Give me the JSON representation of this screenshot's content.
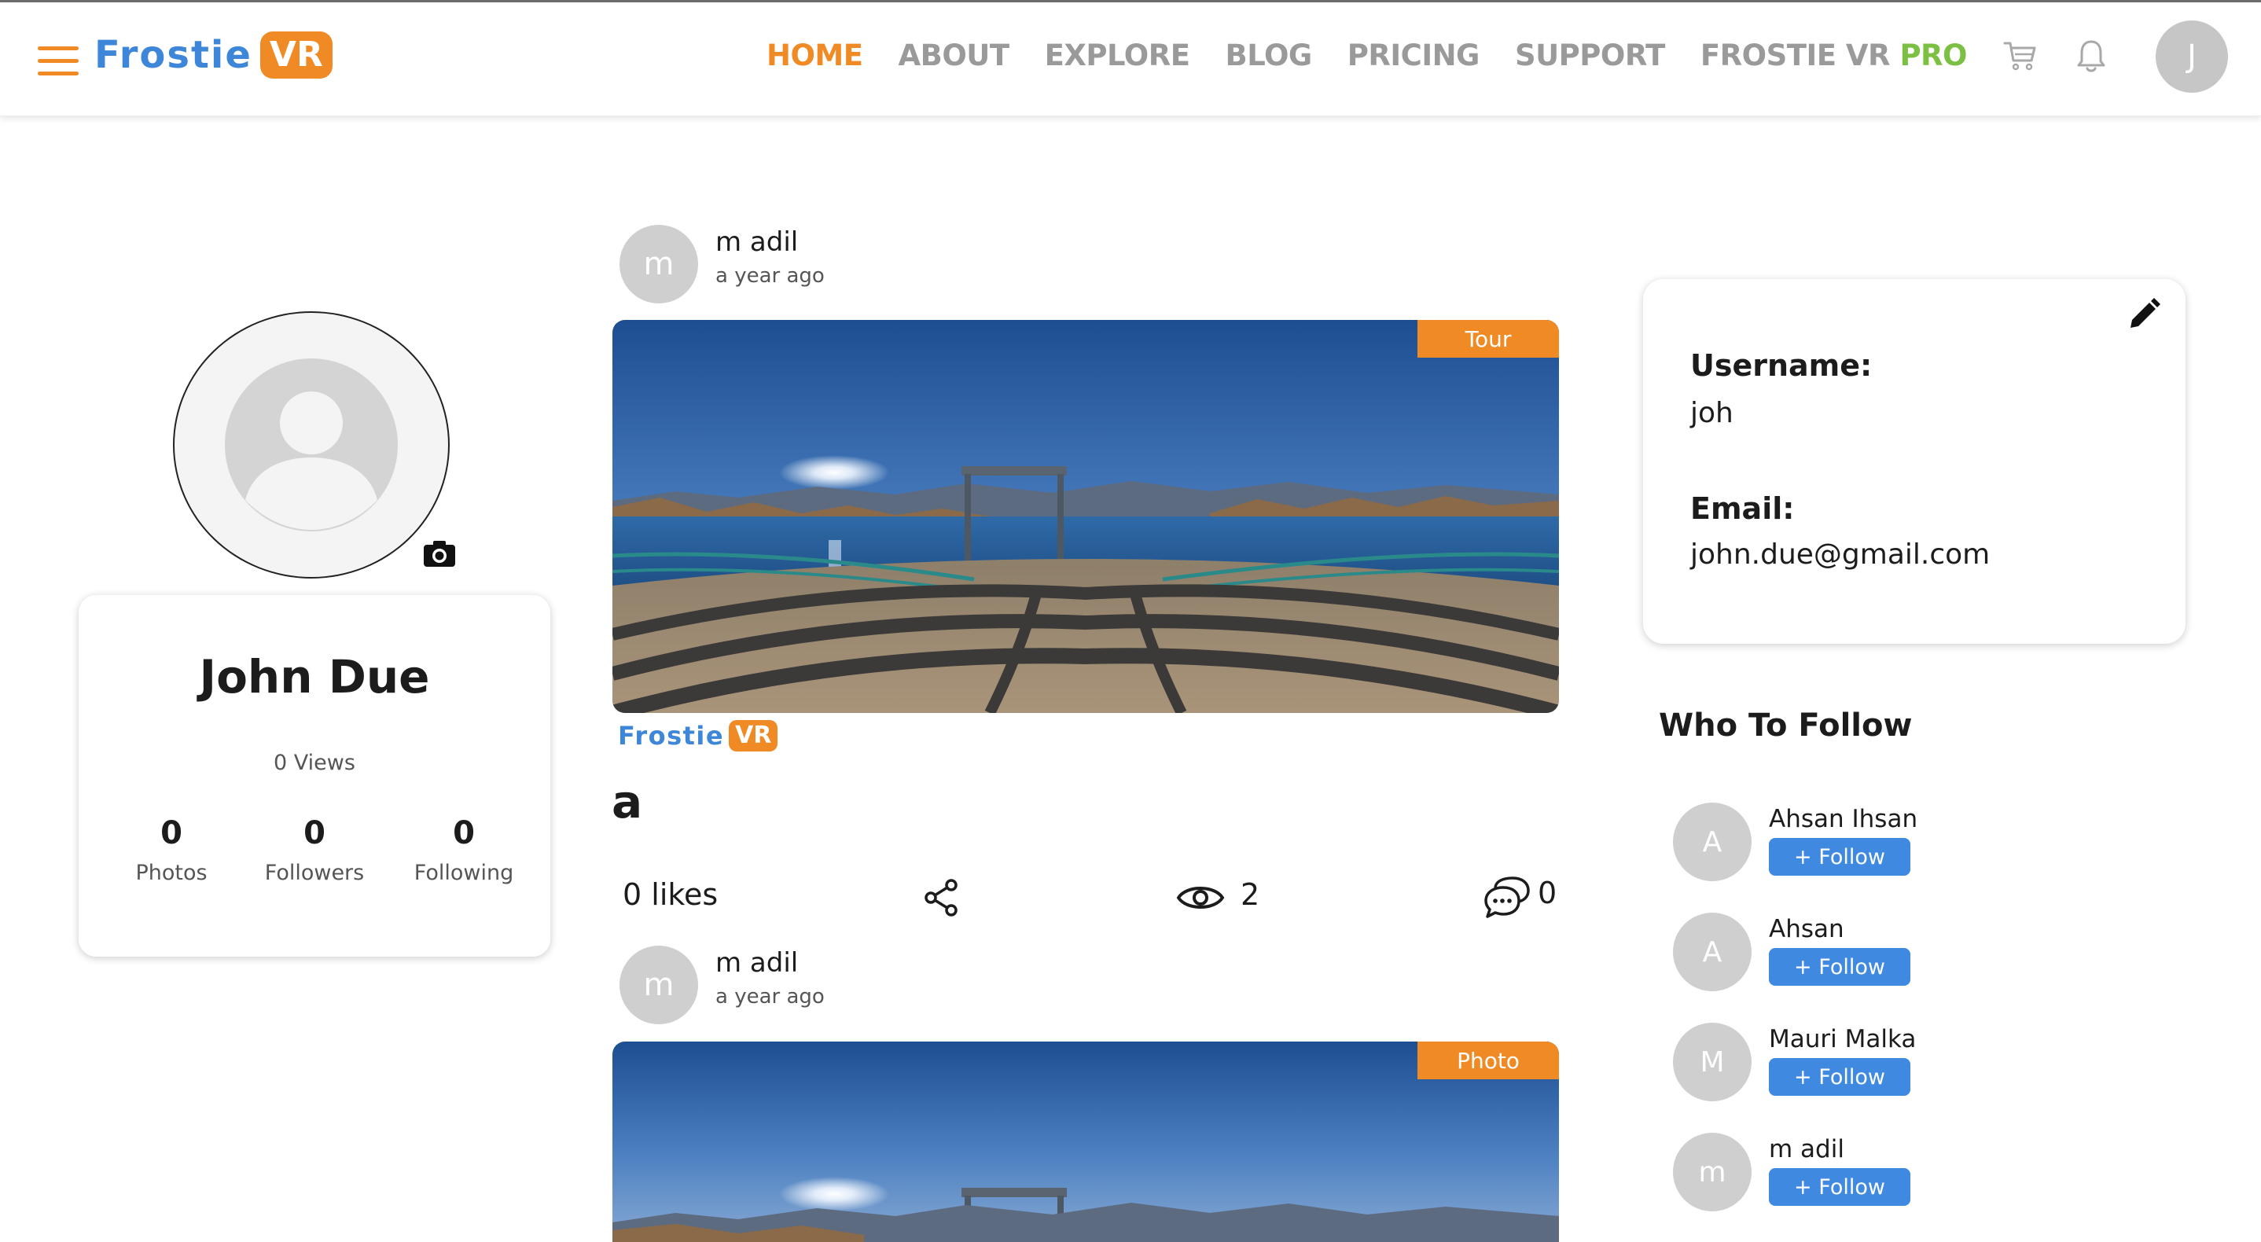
{
  "header": {
    "logo_text": "Frostie",
    "logo_badge": "VR",
    "nav": [
      "HOME",
      "ABOUT",
      "EXPLORE",
      "BLOG",
      "PRICING",
      "SUPPORT"
    ],
    "nav_pro_prefix": "FROSTIE VR",
    "nav_pro_suffix": "PRO",
    "user_initial": "J",
    "icons": [
      "menu-icon",
      "cart-icon",
      "bell-icon"
    ],
    "colors": {
      "accent": "#f08a24",
      "brand_blue": "#3d86d8",
      "pro_green": "#7bc043",
      "nav_gray": "#9a9a9a"
    }
  },
  "profile": {
    "name": "John Due",
    "views": "0 Views",
    "stats": [
      {
        "value": "0",
        "label": "Photos"
      },
      {
        "value": "0",
        "label": "Followers"
      },
      {
        "value": "0",
        "label": "Following"
      }
    ]
  },
  "posts": [
    {
      "avatar_initial": "m",
      "author": "m adil",
      "time": "a year ago",
      "tag": "Tour",
      "watermark_text": "Frostie",
      "watermark_badge": "VR",
      "title": "a",
      "likes": "0 likes",
      "views": "2",
      "comments": "0"
    },
    {
      "avatar_initial": "m",
      "author": "m adil",
      "time": "a year ago",
      "tag": "Photo"
    }
  ],
  "account": {
    "username_label": "Username:",
    "username": "joh",
    "email_label": "Email:",
    "email": "john.due@gmail.com"
  },
  "who_to_follow": {
    "title": "Who To Follow",
    "button_label": "+ Follow",
    "users": [
      {
        "initial": "A",
        "name": "Ahsan Ihsan"
      },
      {
        "initial": "A",
        "name": "Ahsan"
      },
      {
        "initial": "M",
        "name": "Mauri Malka"
      },
      {
        "initial": "m",
        "name": "m adil"
      }
    ]
  }
}
